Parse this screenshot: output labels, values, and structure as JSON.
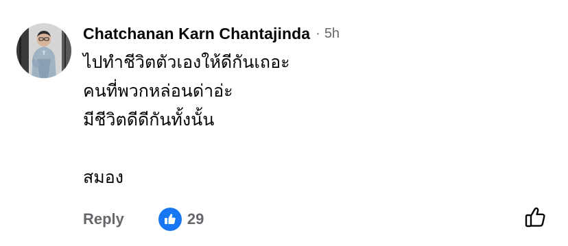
{
  "comment": {
    "author": "Chatchanan Karn Chantajinda",
    "separator": "·",
    "time": "5h",
    "lines": [
      "ไปทำชีวิตตัวเองให้ดีกันเถอะ",
      "คนที่พวกหล่อนด่าอ่ะ",
      "มีชีวิตดีดีกันทั้งนั้น",
      "",
      "สมอง"
    ],
    "reply_label": "Reply",
    "reaction_count": "29",
    "reaction_icon": "thumbs-up-icon",
    "like_action_icon": "thumbs-up-outline-icon",
    "colors": {
      "author": "#050505",
      "meta": "#65676b",
      "like_blue": "#1877f2"
    }
  }
}
